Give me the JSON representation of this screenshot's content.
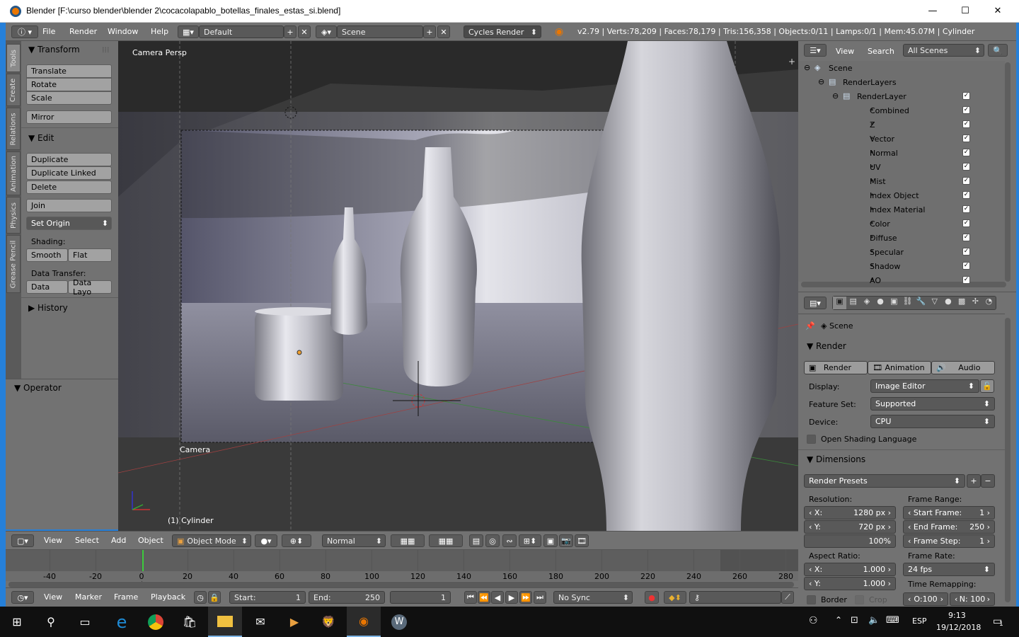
{
  "window": {
    "title": "Blender [F:\\curso blender\\blender 2\\cocacolapablo_botellas_finales_estas_si.blend]",
    "min": "—",
    "max": "☐",
    "close": "✕"
  },
  "info": {
    "menus": [
      "File",
      "Render",
      "Window",
      "Help"
    ],
    "layout": "Default",
    "scene": "Scene",
    "engine": "Cycles Render",
    "stats": "v2.79 | Verts:78,209 | Faces:78,179 | Tris:156,358 | Objects:0/11 | Lamps:0/1 | Mem:45.07M | Cylinder"
  },
  "tabs": [
    "Tools",
    "Create",
    "Relations",
    "Animation",
    "Physics",
    "Grease Pencil"
  ],
  "shelf": {
    "transform_title": "Transform",
    "transform": [
      "Translate",
      "Rotate",
      "Scale"
    ],
    "mirror": "Mirror",
    "edit_title": "Edit",
    "edit": [
      "Duplicate",
      "Duplicate Linked",
      "Delete"
    ],
    "join": "Join",
    "set_origin": "Set Origin",
    "shading_label": "Shading:",
    "smooth": "Smooth",
    "flat": "Flat",
    "data_transfer_label": "Data Transfer:",
    "data": "Data",
    "data_layo": "Data Layo",
    "history": "History",
    "operator": "Operator"
  },
  "viewport": {
    "view_name": "Camera Persp",
    "camera_label": "Camera",
    "object_label": "(1) Cylinder"
  },
  "vp_header": {
    "menus": [
      "View",
      "Select",
      "Add",
      "Object"
    ],
    "mode": "Object Mode",
    "pivot": "Normal"
  },
  "outliner": {
    "menus": [
      "View",
      "Search"
    ],
    "filter": "All Scenes",
    "scene": "Scene",
    "renderlayers": "RenderLayers",
    "renderlayer": "RenderLayer",
    "passes": [
      "Combined",
      "Z",
      "Vector",
      "Normal",
      "UV",
      "Mist",
      "Index Object",
      "Index Material",
      "Color",
      "Diffuse",
      "Specular",
      "Shadow",
      "AO"
    ]
  },
  "props": {
    "context": "Scene",
    "render_title": "Render",
    "render_btn": "Render",
    "animation_btn": "Animation",
    "audio_btn": "Audio",
    "display_label": "Display:",
    "display": "Image Editor",
    "feature_label": "Feature Set:",
    "feature": "Supported",
    "device_label": "Device:",
    "device": "CPU",
    "osl": "Open Shading Language",
    "dimensions_title": "Dimensions",
    "presets": "Render Presets",
    "resolution_label": "Resolution:",
    "res_x_label": "X:",
    "res_x": "1280 px",
    "res_y_label": "Y:",
    "res_y": "720 px",
    "res_pct": "100%",
    "frame_range_label": "Frame Range:",
    "start_label": "Start Frame:",
    "start": "1",
    "end_label": "End Frame:",
    "end": "250",
    "step_label": "Frame Step:",
    "step": "1",
    "aspect_label": "Aspect Ratio:",
    "asp_x_label": "X:",
    "asp_x": "1.000",
    "asp_y_label": "Y:",
    "asp_y": "1.000",
    "fps_label": "Frame Rate:",
    "fps": "24 fps",
    "remap_label": "Time Remapping:",
    "border": "Border",
    "crop": "Crop",
    "o": "O:100",
    "n": "N: 100"
  },
  "timeline": {
    "ticks": [
      "-40",
      "-20",
      "0",
      "20",
      "40",
      "60",
      "80",
      "100",
      "120",
      "140",
      "160",
      "180",
      "200",
      "220",
      "240",
      "260",
      "280"
    ],
    "menus": [
      "View",
      "Marker",
      "Frame",
      "Playback"
    ],
    "start_label": "Start:",
    "start": "1",
    "end_label": "End:",
    "end": "250",
    "current": "1",
    "sync": "No Sync"
  },
  "taskbar": {
    "lang": "ESP",
    "time": "9:13",
    "date": "19/12/2018",
    "notif": "1"
  },
  "colors": {
    "accent": "#2680d9",
    "blender_orange": "#ea7600"
  }
}
